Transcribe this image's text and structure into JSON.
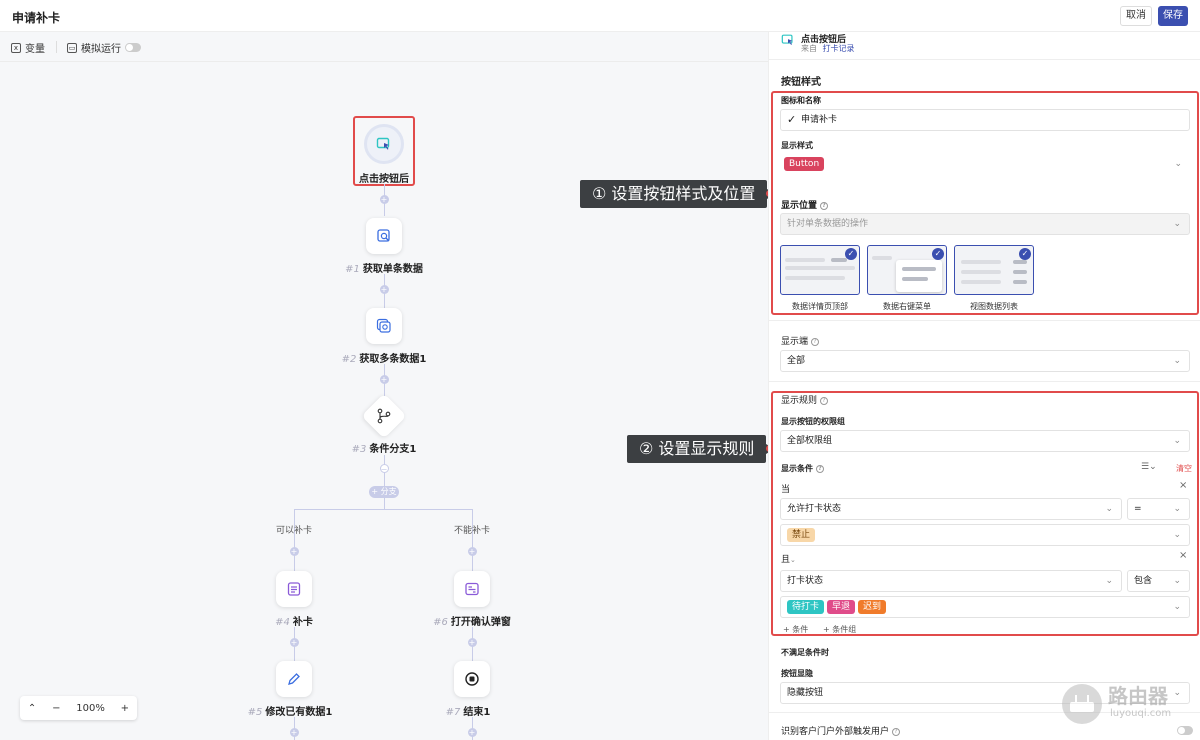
{
  "header": {
    "title": "申请补卡",
    "cancel_label": "取消",
    "save_label": "保存"
  },
  "toolbar": {
    "variables_label": "变量",
    "simulate_label": "模拟运行"
  },
  "flow": {
    "trigger_label": "点击按钮后",
    "nodes": [
      {
        "num": "#1",
        "label": "获取单条数据"
      },
      {
        "num": "#2",
        "label": "获取多条数据1"
      },
      {
        "num": "#3",
        "label": "条件分支1"
      },
      {
        "num": "#4",
        "label": "补卡"
      },
      {
        "num": "#5",
        "label": "修改已有数据1"
      },
      {
        "num": "#6",
        "label": "打开确认弹窗"
      },
      {
        "num": "#7",
        "label": "结束1"
      }
    ],
    "branch_pill": "+ 分支",
    "branch_left": "可以补卡",
    "branch_right": "不能补卡"
  },
  "zoom": {
    "minus": "−",
    "value": "100%",
    "plus": "+",
    "collapse": "⌃"
  },
  "callouts": {
    "first": "① 设置按钮样式及位置",
    "second": "② 设置显示规则"
  },
  "panel": {
    "trigger_title": "点击按钮后",
    "from_prefix": "来自",
    "from_link": "打卡记录",
    "button_style_title": "按钮样式",
    "icon_name_label": "图标和名称",
    "icon_name_value": "申请补卡",
    "display_style_label": "显示样式",
    "display_style_tag": "Button",
    "display_position_label": "显示位置",
    "display_position_placeholder": "针对单条数据的操作",
    "thumbs": [
      "数据详情页顶部",
      "数据右键菜单",
      "视图数据列表"
    ],
    "display_client_label": "显示端",
    "display_client_value": "全部",
    "display_rules_label": "显示规则",
    "permission_group_label": "显示按钮的权限组",
    "permission_group_value": "全部权限组",
    "conditions_label": "显示条件",
    "clear_label": "清空",
    "when_label": "当",
    "cond1_field": "允许打卡状态",
    "cond1_op": "=",
    "cond1_tag": "禁止",
    "and_label": "且",
    "cond2_field": "打卡状态",
    "cond2_op": "包含",
    "cond2_tags": [
      "待打卡",
      "早退",
      "迟到"
    ],
    "add_condition": "条件",
    "add_group": "条件组",
    "unmet_label": "不满足条件时",
    "button_visibility_label": "按钮显隐",
    "button_visibility_value": "隐藏按钮",
    "external_user_label": "识别客户门户外部触发用户"
  },
  "watermark": {
    "cn": "路由器",
    "en": "luyouqi.com"
  },
  "colors": {
    "accent": "#3b4fb0",
    "highlight": "#e14b4b",
    "tag_red": "#d9435e",
    "tag_orange": "#f8d7a8",
    "tag_teal": "#2ec5c3",
    "tag_pink": "#e04c8a",
    "tag_orange2": "#f07b2b"
  }
}
